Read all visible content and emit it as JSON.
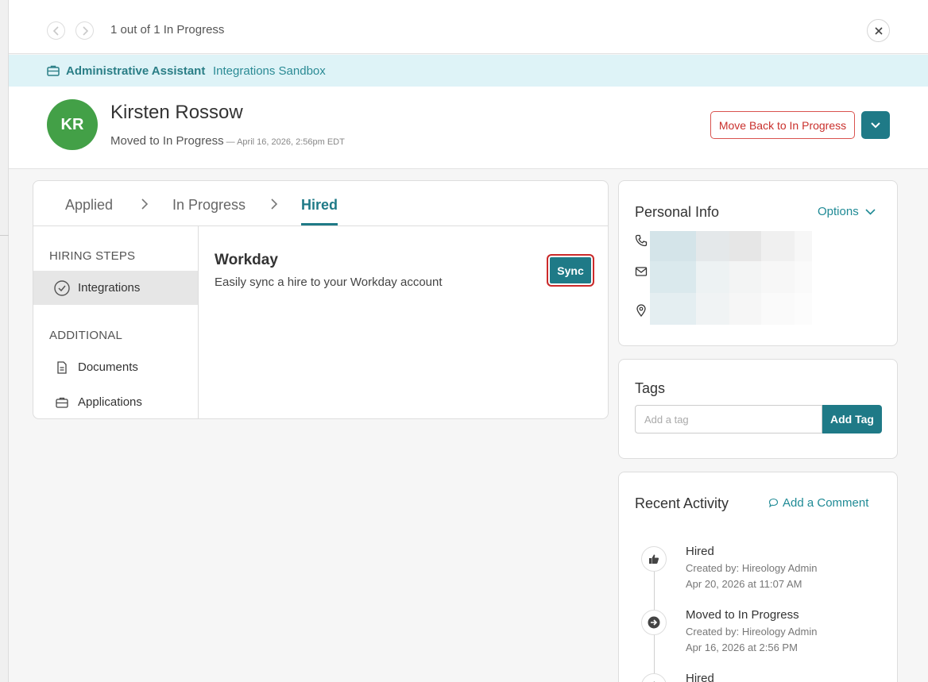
{
  "pager": {
    "text": "1 out of 1 In Progress"
  },
  "job": {
    "title": "Administrative Assistant",
    "location": "Integrations Sandbox"
  },
  "candidate": {
    "initials": "KR",
    "name": "Kirsten Rossow",
    "status": "Moved to In Progress",
    "status_date": " — April 16, 2026, 2:56pm EDT",
    "move_back_label": "Move Back to In Progress"
  },
  "stages": {
    "applied": "Applied",
    "in_progress": "In Progress",
    "hired": "Hired"
  },
  "sidenav": {
    "hiring_steps_heading": "HIRING STEPS",
    "integrations": "Integrations",
    "additional_heading": "ADDITIONAL",
    "documents": "Documents",
    "applications": "Applications"
  },
  "integration": {
    "title": "Workday",
    "description": "Easily sync a hire to your Workday account",
    "sync_label": "Sync"
  },
  "personal_info": {
    "title": "Personal Info",
    "options_label": "Options"
  },
  "tags": {
    "title": "Tags",
    "placeholder": "Add a tag",
    "add_label": "Add Tag"
  },
  "recent_activity": {
    "title": "Recent Activity",
    "add_comment_label": "Add a Comment",
    "events": [
      {
        "title": "Hired",
        "by": "Created by: Hireology Admin",
        "time": "Apr 20, 2026 at 11:07 AM",
        "icon": "thumbs-up-icon"
      },
      {
        "title": "Moved to In Progress",
        "by": "Created by: Hireology Admin",
        "time": "Apr 16, 2026 at 2:56 PM",
        "icon": "arrow-right-icon"
      },
      {
        "title": "Hired",
        "by": "",
        "time": "",
        "icon": "thumbs-up-icon"
      }
    ]
  },
  "colors": {
    "accent": "#1f7a87",
    "avatar": "#43a047",
    "danger": "#c9302c",
    "job_bar": "#def3f7"
  }
}
